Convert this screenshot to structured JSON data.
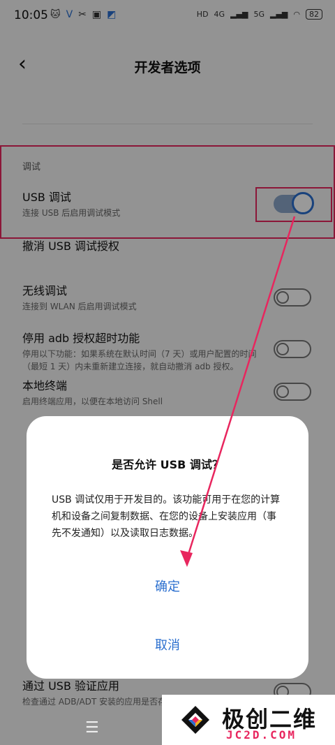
{
  "status_bar": {
    "time": "10:05",
    "left_icons": [
      "cat-icon",
      "v-icon",
      "tools-icon",
      "badge-icon",
      "arrow-app-icon"
    ],
    "signal_1": "4G",
    "signal_2": "5G",
    "hd_label": "HD",
    "battery": "82"
  },
  "header": {
    "title": "开发者选项"
  },
  "section_label": "调试",
  "settings": [
    {
      "title": "USB 调试",
      "subtitle": "连接 USB 后启用调试模式",
      "toggle": "on"
    },
    {
      "title": "撤消 USB 调试授权",
      "subtitle": "",
      "toggle": "none"
    },
    {
      "title": "无线调试",
      "subtitle": "连接到 WLAN 后启用调试模式",
      "toggle": "off"
    },
    {
      "title": "停用 adb 授权超时功能",
      "subtitle": "停用以下功能：如果系统在默认时间（7 天）或用户配置的时间（最短 1 天）内未重新建立连接，就自动撤消 adb 授权。",
      "toggle": "off"
    },
    {
      "title": "本地终端",
      "subtitle": "启用终端应用，以便在本地访问 Shell",
      "toggle": "off"
    },
    {
      "title": "通过 USB 验证应用",
      "subtitle": "检查通过 ADB/ADT 安装的应用是否存在有害行为",
      "toggle": "off"
    }
  ],
  "dialog": {
    "title": "是否允许 USB 调试？",
    "message": "USB 调试仅用于开发目的。该功能可用于在您的计算机和设备之间复制数据、在您的设备上安装应用（事先不发通知）以及读取日志数据。",
    "confirm_label": "确定",
    "cancel_label": "取消"
  },
  "watermark": {
    "title": "极创二维",
    "domain": "JC2D.COM"
  },
  "colors": {
    "accent": "#2b6fcf",
    "highlight": "#e8265e"
  }
}
